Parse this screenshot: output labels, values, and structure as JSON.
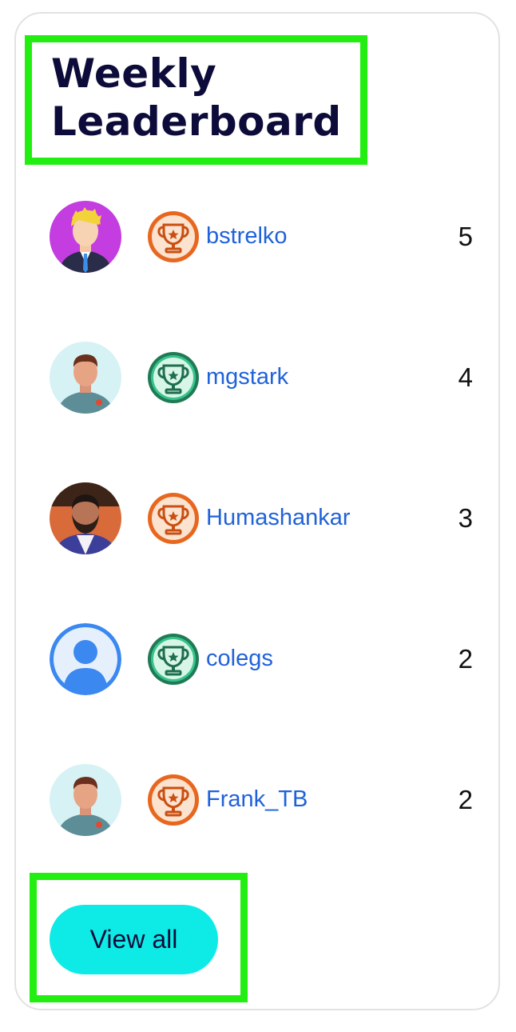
{
  "leaderboard": {
    "title": "Weekly\nLeaderboard",
    "entries": [
      {
        "username": "bstrelko",
        "score": "5",
        "badge": "orange-trophy-icon",
        "avatar": "blonde-man-avatar"
      },
      {
        "username": "mgstark",
        "score": "4",
        "badge": "green-trophy-icon",
        "avatar": "man-avatar"
      },
      {
        "username": "Humashankar",
        "score": "3",
        "badge": "orange-trophy-icon",
        "avatar": "photo-avatar"
      },
      {
        "username": "colegs",
        "score": "2",
        "badge": "green-trophy-icon",
        "avatar": "default-user-avatar"
      },
      {
        "username": "Frank_TB",
        "score": "2",
        "badge": "orange-trophy-icon",
        "avatar": "man-avatar"
      }
    ],
    "view_all_label": "View all"
  },
  "colors": {
    "title": "#0c0b3a",
    "link": "#1f62d9",
    "button": "#0eebe7",
    "highlight": "#22ee11",
    "badge_orange": "#e8671f",
    "badge_green": "#2fbf8a"
  }
}
